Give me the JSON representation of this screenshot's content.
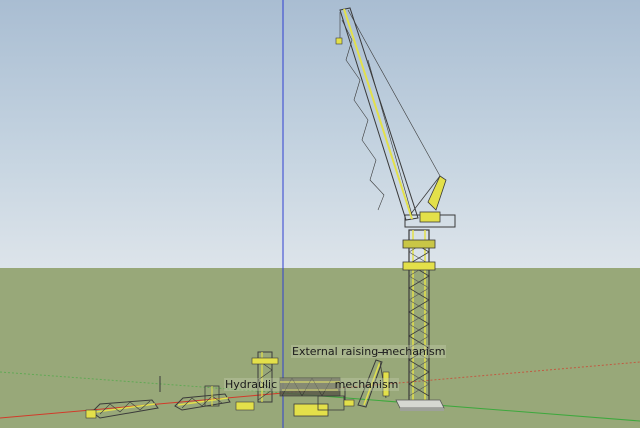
{
  "scene": {
    "sky_color": "#b9c9d9",
    "ground_color": "#98a879",
    "crane_color": "#e3e04a",
    "steel_color": "#3a3a3a",
    "axes": {
      "blue": "#2f3fd1",
      "red": "#d23a2a",
      "green": "#3da83d"
    }
  },
  "labels": {
    "external_raising": "External raising mechanism",
    "hydraulic": "Hydraulic",
    "mechanism_overlap": "mechanism"
  }
}
